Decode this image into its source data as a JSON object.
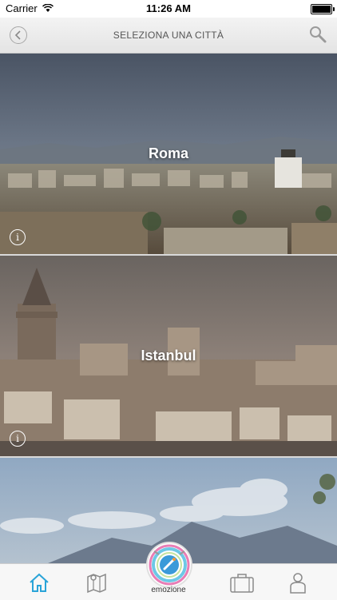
{
  "status": {
    "carrier": "Carrier",
    "time": "11:26 AM"
  },
  "nav": {
    "title": "SELEZIONA UNA CITTÀ"
  },
  "cities": [
    {
      "name": "Roma"
    },
    {
      "name": "Istanbul"
    },
    {
      "name": ""
    }
  ],
  "tabbar": {
    "center_label": "emozione"
  },
  "colors": {
    "accent": "#2aa4d8",
    "tab_inactive": "#8a8a8a"
  }
}
